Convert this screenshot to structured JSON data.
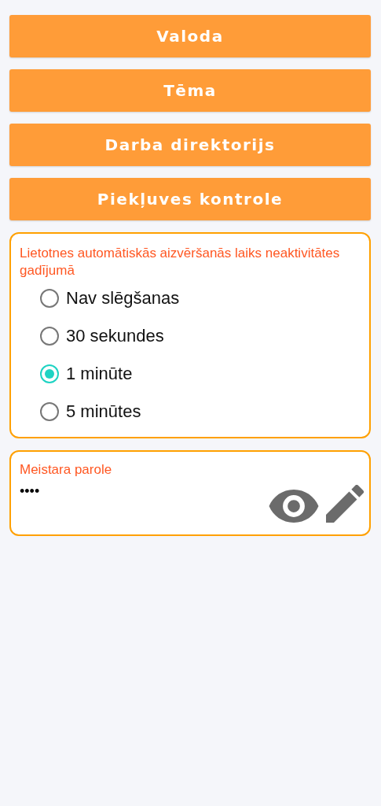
{
  "menu_buttons": [
    {
      "label": "Valoda"
    },
    {
      "label": "Tēma"
    },
    {
      "label": "Darba direktorijs"
    },
    {
      "label": "Piekļuves kontrole"
    }
  ],
  "auto_close": {
    "label": "Lietotnes automātiskās aizvēršanās laiks neaktivitātes gadījumā",
    "options": [
      {
        "label": "Nav slēgšanas",
        "selected": false
      },
      {
        "label": "30 sekundes",
        "selected": false
      },
      {
        "label": "1 minūte",
        "selected": true
      },
      {
        "label": "5 minūtes",
        "selected": false
      }
    ]
  },
  "master_password": {
    "label": "Meistara parole",
    "value": "••••"
  }
}
